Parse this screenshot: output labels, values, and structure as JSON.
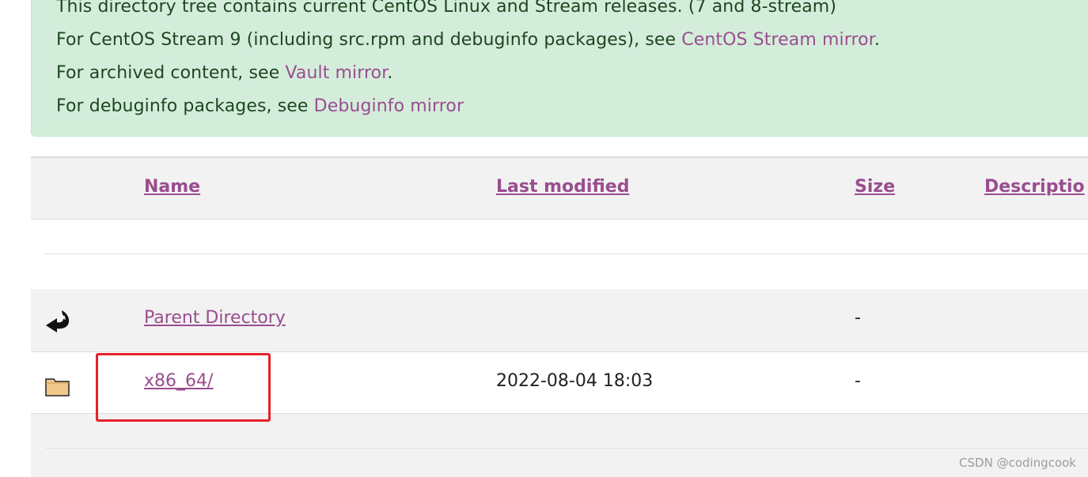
{
  "notice": {
    "line1": "This directory tree contains current CentOS Linux and Stream releases. (7 and 8-stream)",
    "line2_prefix": "For CentOS Stream 9 (including src.rpm and debuginfo packages), see ",
    "line2_link": "CentOS Stream mirror",
    "line2_suffix": ".",
    "line3_prefix": "For archived content, see ",
    "line3_link": "Vault mirror",
    "line3_suffix": ".",
    "line4_prefix": "For debuginfo packages, see ",
    "line4_link": "Debuginfo mirror"
  },
  "table": {
    "headers": {
      "name": "Name",
      "last_modified": "Last modified",
      "size": "Size",
      "description": "Descriptio"
    },
    "rows": [
      {
        "icon": "back-arrow-icon",
        "name": "Parent Directory",
        "last_modified": "",
        "size": "-"
      },
      {
        "icon": "folder-icon",
        "name": "x86_64/",
        "last_modified": "2022-08-04 18:03",
        "size": "-"
      }
    ]
  },
  "colors": {
    "link": "#9a4d8f",
    "alert_bg": "#d4eddb",
    "highlight": "#e5202a"
  },
  "watermark": "CSDN @codingcook"
}
